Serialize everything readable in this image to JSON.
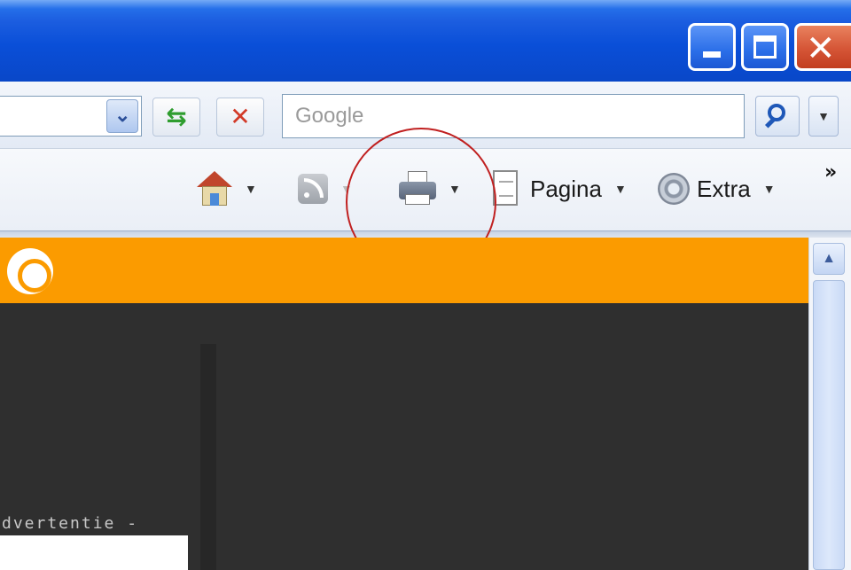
{
  "window": {
    "minimize_icon": "minimize-icon",
    "maximize_icon": "maximize-icon",
    "close_icon": "close-icon",
    "close_glyph": "✕"
  },
  "address_bar": {
    "dropdown_glyph": "⌄",
    "refresh_glyph": "⇆",
    "stop_glyph": "✕"
  },
  "search": {
    "placeholder": "Google",
    "dropdown_glyph": "▼"
  },
  "command_bar": {
    "home_icon": "home-icon",
    "feeds_icon": "rss-feed-icon",
    "print_icon": "printer-icon",
    "page_label": "Pagina",
    "tools_label": "Extra",
    "caret": "▼",
    "more_glyph": "»"
  },
  "content": {
    "advert_text": "dvertentie -"
  },
  "scrollbar": {
    "up_glyph": "▲"
  },
  "colors": {
    "banner": "#fb9b00",
    "page_background": "#2f2f2f",
    "annotation": "#c02020"
  }
}
